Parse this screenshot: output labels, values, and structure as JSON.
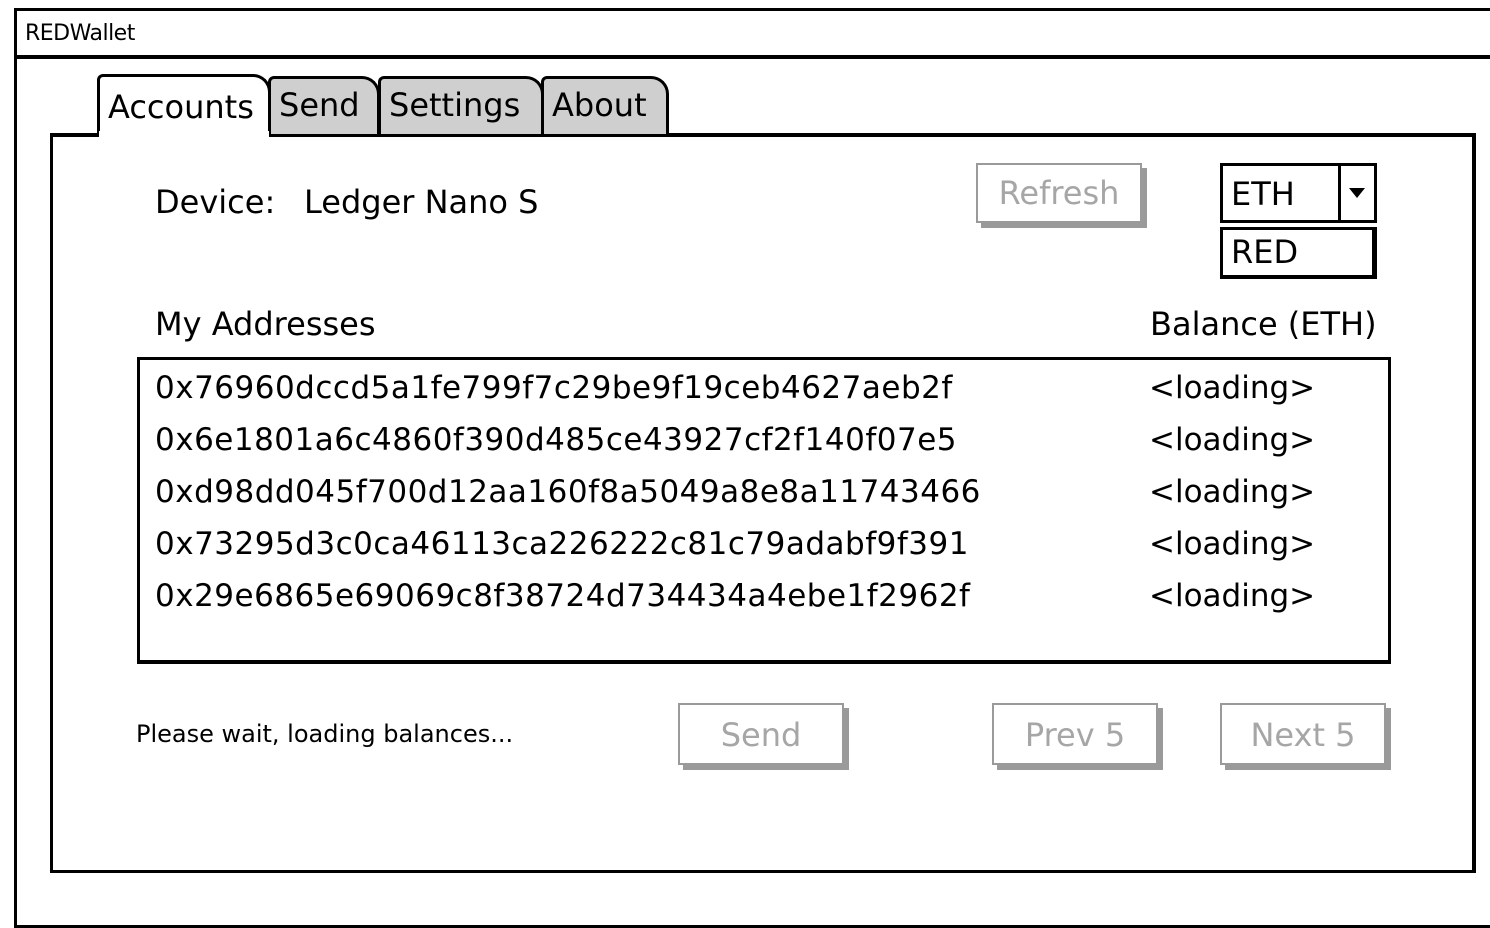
{
  "window": {
    "title": "REDWallet"
  },
  "tabs": [
    {
      "label": "Accounts",
      "active": true
    },
    {
      "label": "Send",
      "active": false
    },
    {
      "label": "Settings",
      "active": false
    },
    {
      "label": "About",
      "active": false
    }
  ],
  "device": {
    "label": "Device:",
    "name": "Ledger Nano S"
  },
  "toolbar": {
    "refresh_label": "Refresh"
  },
  "currency": {
    "selected": "ETH",
    "options_visible": [
      "RED"
    ]
  },
  "addresses": {
    "heading": "My Addresses",
    "balance_heading": "Balance (ETH)",
    "rows": [
      {
        "address": "0x76960dccd5a1fe799f7c29be9f19ceb4627aeb2f",
        "balance": "<loading>"
      },
      {
        "address": "0x6e1801a6c4860f390d485ce43927cf2f140f07e5",
        "balance": "<loading>"
      },
      {
        "address": "0xd98dd045f700d12aa160f8a5049a8e8a11743466",
        "balance": "<loading>"
      },
      {
        "address": "0x73295d3c0ca46113ca226222c81c79adabf9f391",
        "balance": "<loading>"
      },
      {
        "address": "0x29e6865e69069c8f38724d734434a4ebe1f2962f",
        "balance": "<loading>"
      }
    ]
  },
  "footer": {
    "status": "Please wait, loading balances...",
    "send_label": "Send",
    "prev_label": "Prev 5",
    "next_label": "Next 5"
  },
  "colors": {
    "disabled_text": "#a6a6a6",
    "inactive_tab": "#cfcfcf",
    "border": "#000000"
  }
}
